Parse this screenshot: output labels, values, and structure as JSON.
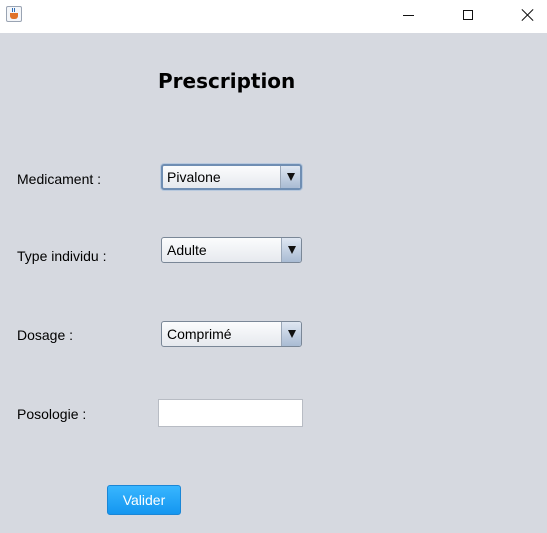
{
  "window": {
    "title": ""
  },
  "form": {
    "title": "Prescription",
    "medicament": {
      "label": "Medicament :",
      "selected": "Pivalone"
    },
    "type_individu": {
      "label": "Type individu :",
      "selected": "Adulte"
    },
    "dosage": {
      "label": "Dosage :",
      "selected": "Comprimé"
    },
    "posologie": {
      "label": "Posologie :",
      "value": ""
    },
    "submit_label": "Valider"
  },
  "colors": {
    "background": "#d6d9e0",
    "button": "#1496f0"
  },
  "icons": {
    "app": "java-coffee-cup-icon",
    "minimize": "minimize-icon",
    "maximize": "maximize-icon",
    "close": "close-icon",
    "dropdown": "triangle-down-icon"
  }
}
